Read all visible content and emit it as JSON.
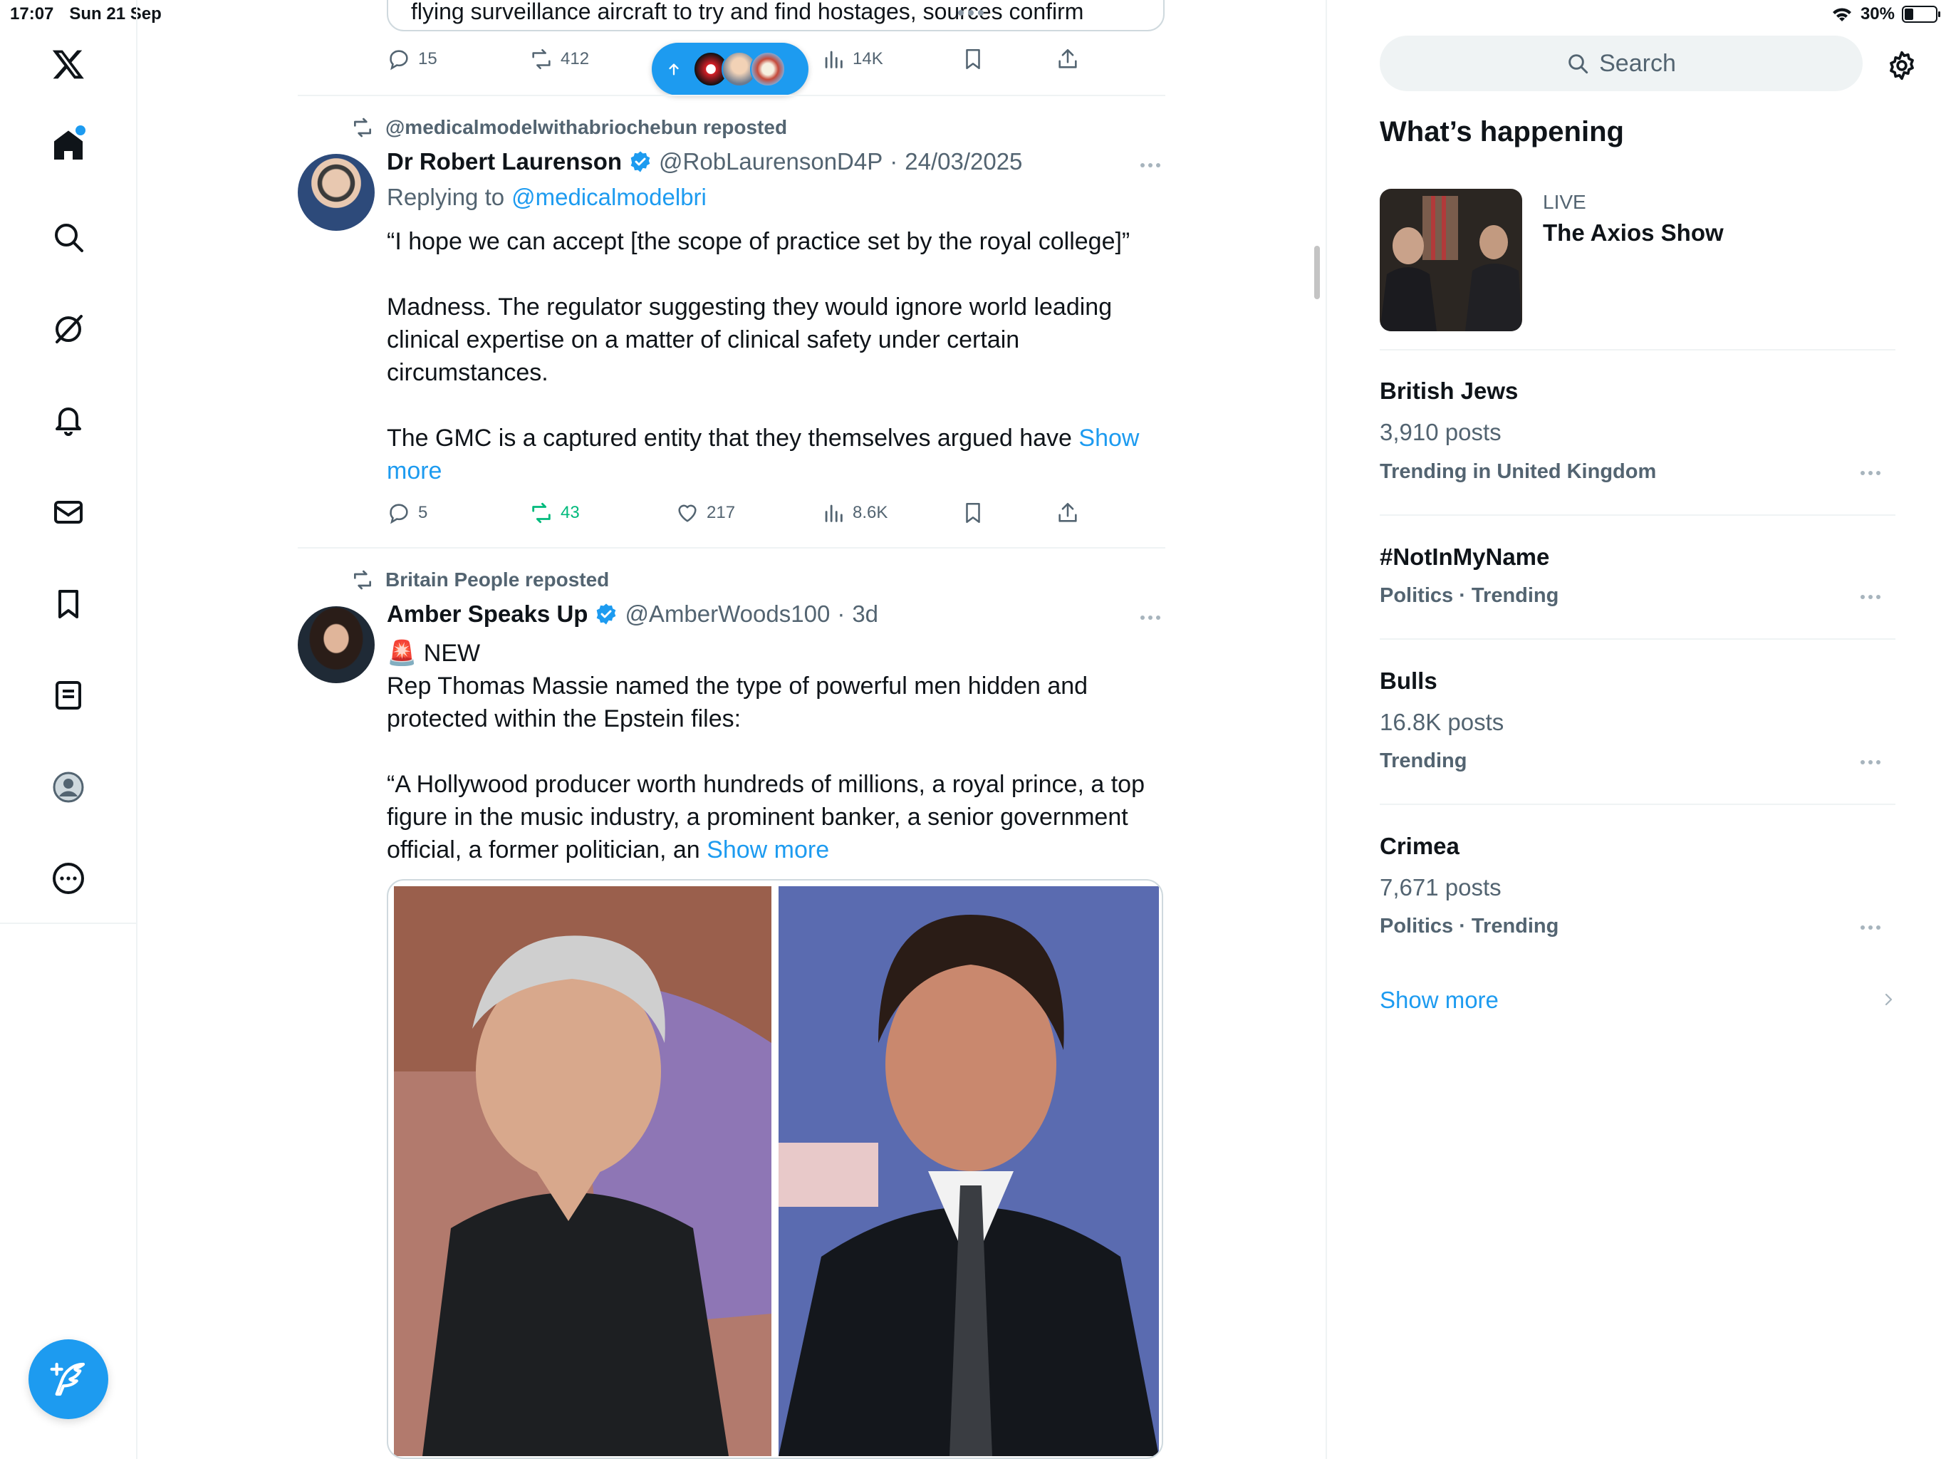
{
  "status": {
    "time": "17:07",
    "date": "Sun 21 Sep",
    "battery": "30%"
  },
  "nav": {
    "items": [
      "logo",
      "home",
      "explore",
      "grok",
      "notifications",
      "messages",
      "bookmarks",
      "lists",
      "profile",
      "more"
    ]
  },
  "top_tweet": {
    "partial_text": "flying surveillance aircraft to try and find hostages, sources confirm",
    "actions": {
      "replies": "15",
      "reposts": "412",
      "views": "14K"
    }
  },
  "tweet1": {
    "repost_by": "@medicalmodelwithabriochebun reposted",
    "name": "Dr Robert Laurenson",
    "handle": "@RobLaurensonD4P",
    "sep": "·",
    "date": "24/03/2025",
    "replying_prefix": "Replying to",
    "replying_to": "@medicalmodelbri",
    "line1": "“I hope we can accept [the scope of practice set by the royal college]”",
    "para2_l1": "Madness. The regulator suggesting they would ignore world leading",
    "para2_l2": "clinical expertise on a matter of clinical safety under certain",
    "para2_l3": "circumstances.",
    "para3_l1": "The GMC is a captured entity that they themselves argued have",
    "show_more_1": "Show",
    "show_more_2": "more",
    "actions": {
      "replies": "5",
      "reposts": "43",
      "likes": "217",
      "views": "8.6K"
    }
  },
  "tweet2": {
    "repost_by": "Britain People reposted",
    "name": "Amber Speaks Up",
    "handle": "@AmberWoods100",
    "sep": "·",
    "date": "3d",
    "badge_emoji": "🚨",
    "new_label": "NEW",
    "line1": "Rep Thomas Massie named the type of powerful men hidden and",
    "line2": "protected within the Epstein files:",
    "quote_l1": "“A Hollywood producer worth hundreds of millions, a royal prince, a top",
    "quote_l2": "figure in the music industry, a prominent banker, a senior government",
    "quote_l3": "official, a former politician, an",
    "show_more": "Show more"
  },
  "right": {
    "search_placeholder": "Search",
    "title": "What’s happening",
    "live_label": "LIVE",
    "live_name": "The Axios Show",
    "trends": [
      {
        "name": "British Jews",
        "posts": "3,910 posts",
        "meta": "Trending in United Kingdom"
      },
      {
        "name": "#NotInMyName",
        "meta": "Politics · Trending"
      },
      {
        "name": "Bulls",
        "posts": "16.8K posts",
        "meta": "Trending"
      },
      {
        "name": "Crimea",
        "posts": "7,671 posts",
        "meta": "Politics · Trending"
      }
    ],
    "show_more": "Show more"
  },
  "colors": {
    "accent": "#1d9bf0",
    "repost_green": "#00ba7c",
    "muted": "#536471",
    "text": "#0f1419"
  },
  "icons": [
    "x-logo-icon",
    "home-icon",
    "search-icon",
    "grok-icon",
    "bell-icon",
    "mail-icon",
    "bookmark-icon",
    "list-icon",
    "profile-icon",
    "more-circle-icon",
    "reply-icon",
    "repost-icon",
    "like-icon",
    "views-icon",
    "share-icon",
    "verified-icon",
    "gear-icon",
    "compose-icon",
    "wifi-icon",
    "battery-icon"
  ]
}
